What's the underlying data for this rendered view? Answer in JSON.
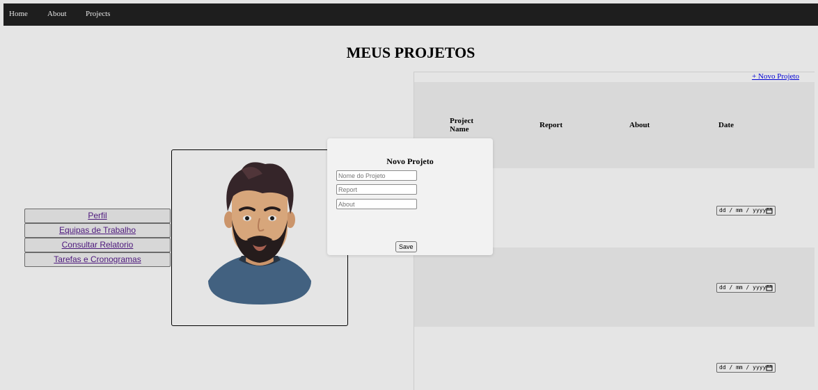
{
  "nav": {
    "items": [
      "Home",
      "About",
      "Projects"
    ]
  },
  "page": {
    "title": "MEUS PROJETOS"
  },
  "sidebar": {
    "items": [
      "Perfil",
      "Equipas de Trabalho",
      "Consultar Relatorio",
      "Tarefas e Cronogramas"
    ]
  },
  "projects": {
    "new_link": "+ Novo Projeto",
    "columns": [
      "Project Name",
      "Report",
      "About",
      "Date"
    ],
    "rows": [
      {
        "date_placeholder": "dd / mm / yyyy"
      },
      {
        "date_placeholder": "dd / mm / yyyy"
      },
      {
        "date_placeholder": "dd / mm / yyyy"
      }
    ]
  },
  "modal": {
    "title": "Novo Projeto",
    "fields": {
      "name_placeholder": "Nome do Projeto",
      "report_placeholder": "Report",
      "about_placeholder": "About"
    },
    "save_label": "Save"
  },
  "colors": {
    "navbar": "#222222",
    "modal_bg": "#f2f2f2",
    "link": "#0000ee",
    "visited_link": "#551a8b",
    "row_alt": "#f2f2f2"
  }
}
